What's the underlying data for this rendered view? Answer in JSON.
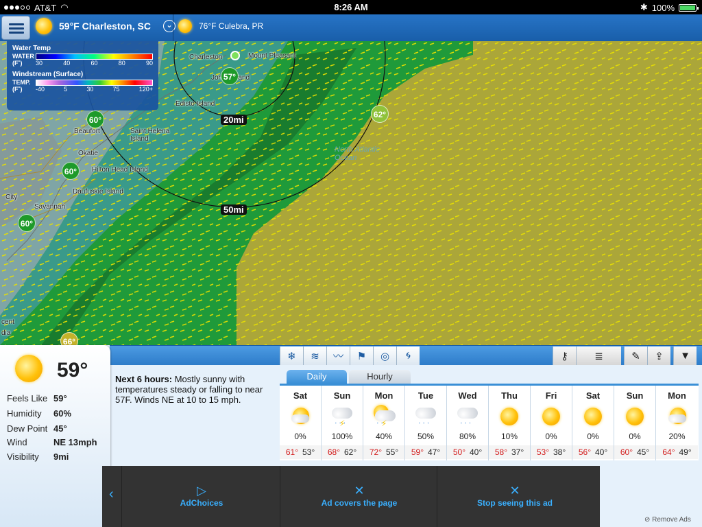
{
  "status_bar": {
    "carrier": "AT&T",
    "time": "8:26 AM",
    "battery": "100%"
  },
  "location_bar": {
    "primary": "59°F Charleston, SC",
    "secondary": "76°F Culebra, PR"
  },
  "legend": {
    "water_title": "Water Temp",
    "water_key": "WATER",
    "water_unit": "(F˚)",
    "water_ticks": [
      "30",
      "40",
      "60",
      "80",
      "90"
    ],
    "wind_title": "Windstream (Surface)",
    "wind_key": "TEMP.",
    "wind_unit": "(F˚)",
    "wind_ticks": [
      "-40",
      "5",
      "30",
      "75",
      "120+"
    ]
  },
  "map": {
    "ranges": [
      "20mi",
      "50mi"
    ],
    "places": [
      "Charleston",
      "Mount Pleasant",
      "Johns Island",
      "Edisto Island",
      "Beaufort",
      "Saint Helena Island",
      "Okatie",
      "Hilton Head Island",
      "Daufuskie Island",
      "Savannah",
      "City",
      "North Atlantic Ocean",
      "cent",
      "dia"
    ],
    "pins": [
      "57°",
      "62°",
      "60°",
      "60°",
      "60°",
      "66°"
    ]
  },
  "current": {
    "temp": "59°",
    "rows": [
      {
        "label": "Feels Like",
        "value": "59°"
      },
      {
        "label": "Humidity",
        "value": "60%"
      },
      {
        "label": "Dew Point",
        "value": "45°"
      },
      {
        "label": "Wind",
        "value": "NE 13mph"
      },
      {
        "label": "Visibility",
        "value": "9mi"
      }
    ]
  },
  "next_hours": {
    "lead": "Next 6 hours:",
    "text": " Mostly sunny with temperatures steady or falling to near 57F. Winds NE at 10 to 15 mph."
  },
  "forecast_tabs": [
    "Daily",
    "Hourly"
  ],
  "forecast": [
    {
      "day": "Sat",
      "icon": "partly-sunny-icon",
      "pop": "0%",
      "hi": "61°",
      "lo": "53°"
    },
    {
      "day": "Sun",
      "icon": "thunderstorm-icon",
      "pop": "100%",
      "hi": "68°",
      "lo": "62°"
    },
    {
      "day": "Mon",
      "icon": "sun-thunderstorm-icon",
      "pop": "40%",
      "hi": "72°",
      "lo": "55°"
    },
    {
      "day": "Tue",
      "icon": "rain-cloud-icon",
      "pop": "50%",
      "hi": "59°",
      "lo": "47°"
    },
    {
      "day": "Wed",
      "icon": "rain-cloud-icon",
      "pop": "80%",
      "hi": "50°",
      "lo": "40°"
    },
    {
      "day": "Thu",
      "icon": "sun-icon",
      "pop": "10%",
      "hi": "58°",
      "lo": "37°"
    },
    {
      "day": "Fri",
      "icon": "sun-icon",
      "pop": "0%",
      "hi": "53°",
      "lo": "38°"
    },
    {
      "day": "Sat",
      "icon": "sun-icon",
      "pop": "0%",
      "hi": "56°",
      "lo": "40°"
    },
    {
      "day": "Sun",
      "icon": "sun-icon",
      "pop": "0%",
      "hi": "60°",
      "lo": "45°"
    },
    {
      "day": "Mon",
      "icon": "partly-sunny-icon",
      "pop": "20%",
      "hi": "64°",
      "lo": "49°"
    }
  ],
  "ad": {
    "choices": "AdChoices",
    "covers": "Ad covers the page",
    "stop": "Stop seeing this ad",
    "remove": "Remove Ads"
  }
}
